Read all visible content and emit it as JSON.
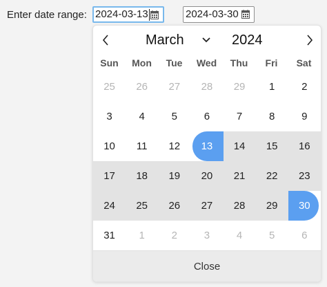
{
  "form": {
    "label": "Enter date range:",
    "start_value": "2024-03-13",
    "end_value": "2024-03-30"
  },
  "calendar": {
    "month": "March",
    "year": "2024",
    "weekdays": [
      "Sun",
      "Mon",
      "Tue",
      "Wed",
      "Thu",
      "Fri",
      "Sat"
    ],
    "days": [
      {
        "n": "25",
        "state": "muted"
      },
      {
        "n": "26",
        "state": "muted"
      },
      {
        "n": "27",
        "state": "muted"
      },
      {
        "n": "28",
        "state": "muted"
      },
      {
        "n": "29",
        "state": "muted"
      },
      {
        "n": "1",
        "state": ""
      },
      {
        "n": "2",
        "state": ""
      },
      {
        "n": "3",
        "state": ""
      },
      {
        "n": "4",
        "state": ""
      },
      {
        "n": "5",
        "state": ""
      },
      {
        "n": "6",
        "state": ""
      },
      {
        "n": "7",
        "state": ""
      },
      {
        "n": "8",
        "state": ""
      },
      {
        "n": "9",
        "state": ""
      },
      {
        "n": "10",
        "state": ""
      },
      {
        "n": "11",
        "state": ""
      },
      {
        "n": "12",
        "state": ""
      },
      {
        "n": "13",
        "state": "sel-start"
      },
      {
        "n": "14",
        "state": "inrange"
      },
      {
        "n": "15",
        "state": "inrange"
      },
      {
        "n": "16",
        "state": "inrange"
      },
      {
        "n": "17",
        "state": "inrange"
      },
      {
        "n": "18",
        "state": "inrange"
      },
      {
        "n": "19",
        "state": "inrange"
      },
      {
        "n": "20",
        "state": "inrange"
      },
      {
        "n": "21",
        "state": "inrange"
      },
      {
        "n": "22",
        "state": "inrange"
      },
      {
        "n": "23",
        "state": "inrange"
      },
      {
        "n": "24",
        "state": "inrange"
      },
      {
        "n": "25",
        "state": "inrange"
      },
      {
        "n": "26",
        "state": "inrange"
      },
      {
        "n": "27",
        "state": "inrange"
      },
      {
        "n": "28",
        "state": "inrange"
      },
      {
        "n": "29",
        "state": "inrange"
      },
      {
        "n": "30",
        "state": "sel-end"
      },
      {
        "n": "31",
        "state": ""
      },
      {
        "n": "1",
        "state": "muted"
      },
      {
        "n": "2",
        "state": "muted"
      },
      {
        "n": "3",
        "state": "muted"
      },
      {
        "n": "4",
        "state": "muted"
      },
      {
        "n": "5",
        "state": "muted"
      },
      {
        "n": "6",
        "state": "muted"
      }
    ],
    "close_label": "Close"
  },
  "icons": {
    "calendar": "calendar-icon",
    "prev": "chevron-left-icon",
    "next": "chevron-right-icon",
    "month_dropdown": "chevron-down-icon"
  },
  "colors": {
    "selected": "#5b9ff0",
    "range": "#e3e3e3",
    "focus_border": "#78b8ec"
  }
}
